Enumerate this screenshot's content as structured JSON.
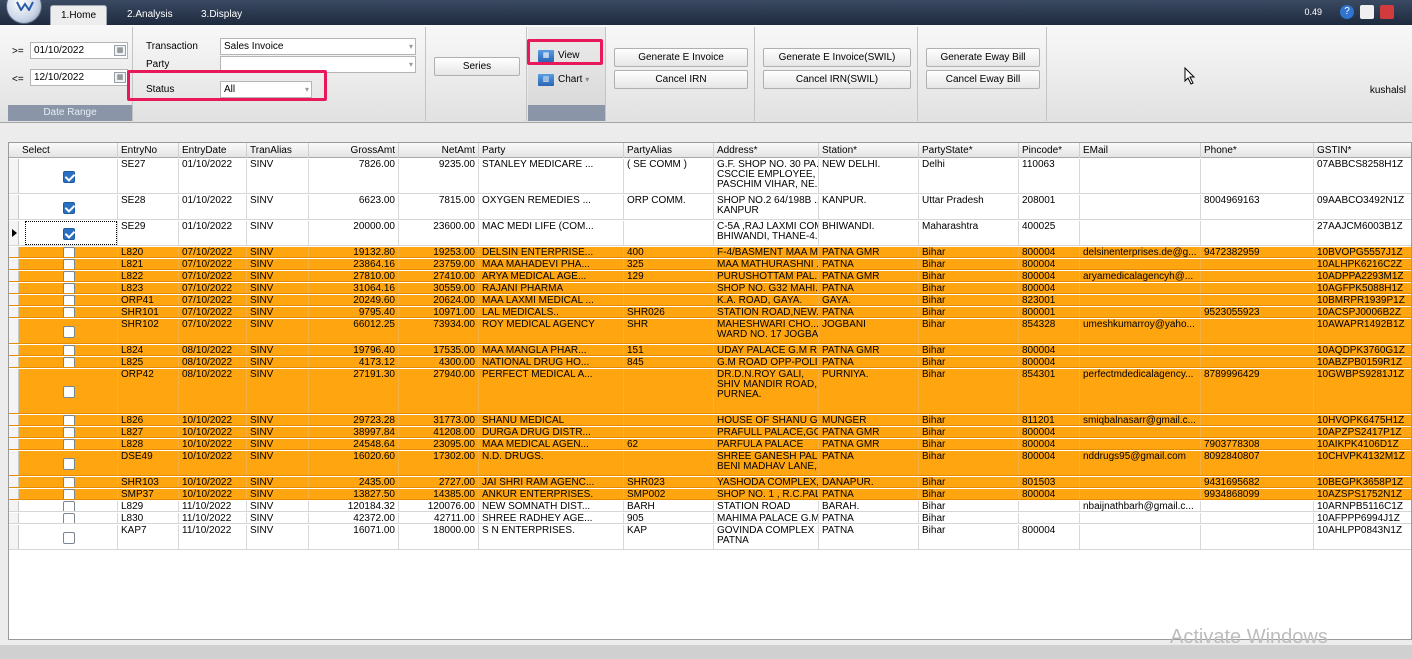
{
  "tabs": [
    {
      "label": "1.Home"
    },
    {
      "label": "2.Analysis"
    },
    {
      "label": "3.Display"
    }
  ],
  "version": "0.49",
  "date_range": {
    "from_prefix": ">=",
    "from_value": "01/10/2022",
    "to_prefix": "<=",
    "to_value": "12/10/2022",
    "group_label": "Date Range"
  },
  "filters": {
    "transaction_label": "Transaction",
    "transaction_value": "Sales Invoice",
    "party_label": "Party",
    "party_value": "",
    "status_label": "Status",
    "status_value": "All"
  },
  "buttons": {
    "series": "Series",
    "view": "View",
    "chart": "Chart",
    "generate_e_invoice": "Generate E Invoice",
    "cancel_irn": "Cancel IRN",
    "generate_e_invoice_swil": "Generate E Invoice(SWIL)",
    "cancel_irn_swil": "Cancel IRN(SWIL)",
    "generate_eway_bill": "Generate Eway Bill",
    "cancel_eway_bill": "Cancel Eway Bill"
  },
  "username": "kushalsl",
  "watermark": "Activate Windows",
  "columns": [
    "Select",
    "EntryNo",
    "EntryDate",
    "TranAlias",
    "GrossAmt",
    "NetAmt",
    "Party",
    "PartyAlias",
    "Address*",
    "Station*",
    "PartyState*",
    "Pincode*",
    "EMail",
    "Phone*",
    "GSTIN*"
  ],
  "rows": [
    {
      "checked": true,
      "color": "white",
      "lines": 3,
      "entry": "SE27",
      "date": "01/10/2022",
      "alias": "SINV",
      "gross": "7826.00",
      "net": "9235.00",
      "party": "STANLEY MEDICARE ...",
      "palias": "( SE COMM )",
      "address": "G.F. SHOP NO. 30 PA...\nCSCCIE EMPLOYEE, ...\nPASCHIM VIHAR, NE...",
      "station": "NEW DELHI.",
      "state": "Delhi",
      "pin": "110063",
      "email": "",
      "phone": "",
      "gstin": "07ABBCS8258H1Z"
    },
    {
      "checked": true,
      "color": "white",
      "lines": 2,
      "entry": "SE28",
      "date": "01/10/2022",
      "alias": "SINV",
      "gross": "6623.00",
      "net": "7815.00",
      "party": "OXYGEN REMEDIES ...",
      "palias": "ORP COMM.",
      "address": "SHOP NO.2 64/198B ...\nKANPUR",
      "station": "KANPUR.",
      "state": "Uttar Pradesh",
      "pin": "208001",
      "email": "",
      "phone": "8004969163",
      "gstin": "09AABCO3492N1Z"
    },
    {
      "checked": true,
      "color": "white",
      "lines": 2,
      "current": true,
      "entry": "SE29",
      "date": "01/10/2022",
      "alias": "SINV",
      "gross": "20000.00",
      "net": "23600.00",
      "party": "MAC MEDI LIFE (COM...",
      "palias": "",
      "address": "C-5A ,RAJ LAXMI COM...\nBHIWANDI, THANE-4...",
      "station": "BHIWANDI.",
      "state": "Maharashtra",
      "pin": "400025",
      "email": "",
      "phone": "",
      "gstin": "27AAJCM6003B1Z"
    },
    {
      "checked": false,
      "color": "orange",
      "lines": 1,
      "entry": "L820",
      "date": "07/10/2022",
      "alias": "SINV",
      "gross": "19132.80",
      "net": "19253.00",
      "party": "DELSIN ENTERPRISE...",
      "palias": "400",
      "address": "F-4/BASMENT MAA M...",
      "station": "PATNA GMR",
      "state": "Bihar",
      "pin": "800004",
      "email": "delsinenterprises.de@g...",
      "phone": "9472382959",
      "gstin": "10BVOPG5557J1Z"
    },
    {
      "checked": false,
      "color": "orange",
      "lines": 1,
      "entry": "L821",
      "date": "07/10/2022",
      "alias": "SINV",
      "gross": "23864.16",
      "net": "23759.00",
      "party": "MAA MAHADEVI PHA...",
      "palias": "325",
      "address": "MAA MATHURASHNI ...",
      "station": "PATNA",
      "state": "Bihar",
      "pin": "800004",
      "email": "",
      "phone": "",
      "gstin": "10ALHPK6216C2Z"
    },
    {
      "checked": false,
      "color": "orange",
      "lines": 1,
      "entry": "L822",
      "date": "07/10/2022",
      "alias": "SINV",
      "gross": "27810.00",
      "net": "27410.00",
      "party": "ARYA MEDICAL AGE...",
      "palias": "129",
      "address": "PURUSHOTTAM PAL...",
      "station": "PATNA GMR",
      "state": "Bihar",
      "pin": "800004",
      "email": "aryamedicalagencyh@...",
      "phone": "",
      "gstin": "10ADPPA2293M1Z"
    },
    {
      "checked": false,
      "color": "orange",
      "lines": 1,
      "entry": "L823",
      "date": "07/10/2022",
      "alias": "SINV",
      "gross": "31064.16",
      "net": "30559.00",
      "party": "RAJANI PHARMA",
      "palias": "",
      "address": "SHOP NO. G32 MAHI...",
      "station": "PATNA",
      "state": "Bihar",
      "pin": "800004",
      "email": "",
      "phone": "",
      "gstin": "10AGFPK5088H1Z"
    },
    {
      "checked": false,
      "color": "orange",
      "lines": 1,
      "entry": "ORP41",
      "date": "07/10/2022",
      "alias": "SINV",
      "gross": "20249.60",
      "net": "20624.00",
      "party": "MAA LAXMI MEDICAL ...",
      "palias": "",
      "address": "K.A. ROAD, GAYA.",
      "station": "GAYA.",
      "state": "Bihar",
      "pin": "823001",
      "email": "",
      "phone": "",
      "gstin": "10BMRPR1939P1Z"
    },
    {
      "checked": false,
      "color": "orange",
      "lines": 1,
      "entry": "SHR101",
      "date": "07/10/2022",
      "alias": "SINV",
      "gross": "9795.40",
      "net": "10971.00",
      "party": "LAL MEDICALS..",
      "palias": "SHR026",
      "address": "STATION ROAD,NEW...",
      "station": "PATNA",
      "state": "Bihar",
      "pin": "800001",
      "email": "",
      "phone": "9523055923",
      "gstin": "10ACSPJ0006B2Z"
    },
    {
      "checked": false,
      "color": "orange",
      "lines": 2,
      "entry": "SHR102",
      "date": "07/10/2022",
      "alias": "SINV",
      "gross": "66012.25",
      "net": "73934.00",
      "party": "ROY MEDICAL AGENCY",
      "palias": "SHR",
      "address": "MAHESHWARI CHO...\nWARD NO. 17 JOGBA...",
      "station": "JOGBANI",
      "state": "Bihar",
      "pin": "854328",
      "email": "umeshkumarroy@yaho...",
      "phone": "",
      "gstin": "10AWAPR1492B1Z"
    },
    {
      "checked": false,
      "color": "orange",
      "lines": 1,
      "entry": "L824",
      "date": "08/10/2022",
      "alias": "SINV",
      "gross": "19796.40",
      "net": "17535.00",
      "party": "MAA MANGLA PHAR...",
      "palias": "151",
      "address": "UDAY PALACE G.M R...",
      "station": "PATNA GMR",
      "state": "Bihar",
      "pin": "800004",
      "email": "",
      "phone": "",
      "gstin": "10AQDPK3760G1Z"
    },
    {
      "checked": false,
      "color": "orange",
      "lines": 1,
      "entry": "L825",
      "date": "08/10/2022",
      "alias": "SINV",
      "gross": "4173.12",
      "net": "4300.00",
      "party": "NATIONAL DRUG HO...",
      "palias": "845",
      "address": "G.M ROAD OPP-POLI...",
      "station": "PATNA",
      "state": "Bihar",
      "pin": "800004",
      "email": "",
      "phone": "",
      "gstin": "10ABZPB0159R1Z"
    },
    {
      "checked": false,
      "color": "orange",
      "lines": 4,
      "entry": "ORP42",
      "date": "08/10/2022",
      "alias": "SINV",
      "gross": "27191.30",
      "net": "27940.00",
      "party": "PERFECT MEDICAL A...",
      "palias": "",
      "address": "DR.D.N.ROY GALI,\nSHIV MANDIR ROAD,...\nPURNEA.",
      "station": "PURNIYA.",
      "state": "Bihar",
      "pin": "854301",
      "email": "perfectmdedicalagency...",
      "phone": "8789996429",
      "gstin": "10GWBPS9281J1Z"
    },
    {
      "checked": false,
      "color": "orange",
      "lines": 1,
      "entry": "L826",
      "date": "10/10/2022",
      "alias": "SINV",
      "gross": "29723.28",
      "net": "31773.00",
      "party": "SHANU MEDICAL",
      "palias": "",
      "address": "HOUSE OF SHANU G...",
      "station": "MUNGER",
      "state": "Bihar",
      "pin": "811201",
      "email": "smiqbalnasarr@gmail.c...",
      "phone": "",
      "gstin": "10HVOPK6475H1Z"
    },
    {
      "checked": false,
      "color": "orange",
      "lines": 1,
      "entry": "L827",
      "date": "10/10/2022",
      "alias": "SINV",
      "gross": "38997.84",
      "net": "41208.00",
      "party": "DURGA DRUG DISTR...",
      "palias": "",
      "address": "PRAFULL PALACE,GO...",
      "station": "PATNA GMR",
      "state": "Bihar",
      "pin": "800004",
      "email": "",
      "phone": "",
      "gstin": "10APZPS2417P1Z"
    },
    {
      "checked": false,
      "color": "orange",
      "lines": 1,
      "entry": "L828",
      "date": "10/10/2022",
      "alias": "SINV",
      "gross": "24548.64",
      "net": "23095.00",
      "party": "MAA MEDICAL AGEN...",
      "palias": "62",
      "address": "PARFULA PALACE",
      "station": "PATNA GMR",
      "state": "Bihar",
      "pin": "800004",
      "email": "",
      "phone": "7903778308",
      "gstin": "10AIKPK4106D1Z"
    },
    {
      "checked": false,
      "color": "orange",
      "lines": 2,
      "entry": "DSE49",
      "date": "10/10/2022",
      "alias": "SINV",
      "gross": "16020.60",
      "net": "17302.00",
      "party": "N.D. DRUGS.",
      "palias": "",
      "address": "SHREE GANESH PAL...\nBENI MADHAV LANE,...",
      "station": "PATNA",
      "state": "Bihar",
      "pin": "800004",
      "email": "nddrugs95@gmail.com",
      "phone": "8092840807",
      "gstin": "10CHVPK4132M1Z"
    },
    {
      "checked": false,
      "color": "orange",
      "lines": 1,
      "entry": "SHR103",
      "date": "10/10/2022",
      "alias": "SINV",
      "gross": "2435.00",
      "net": "2727.00",
      "party": "JAI SHRI RAM AGENC...",
      "palias": "SHR023",
      "address": "YASHODA COMPLEX,...",
      "station": "DANAPUR.",
      "state": "Bihar",
      "pin": "801503",
      "email": "",
      "phone": "9431695682",
      "gstin": "10BEGPK3658P1Z"
    },
    {
      "checked": false,
      "color": "orange",
      "lines": 1,
      "entry": "SMP37",
      "date": "10/10/2022",
      "alias": "SINV",
      "gross": "13827.50",
      "net": "14385.00",
      "party": "ANKUR ENTERPRISES.",
      "palias": "SMP002",
      "address": "SHOP NO. 1 , R.C.PAL...",
      "station": "PATNA",
      "state": "Bihar",
      "pin": "800004",
      "email": "",
      "phone": "9934868099",
      "gstin": "10AZSPS1752N1Z"
    },
    {
      "checked": false,
      "color": "white",
      "lines": 1,
      "entry": "L829",
      "date": "11/10/2022",
      "alias": "SINV",
      "gross": "120184.32",
      "net": "120076.00",
      "party": "NEW SOMNATH DIST...",
      "palias": "BARH",
      "address": "STATION ROAD",
      "station": "BARAH.",
      "state": "Bihar",
      "pin": "",
      "email": "nbaijnathbarh@gmail.c...",
      "phone": "",
      "gstin": "10ARNPB5116C1Z"
    },
    {
      "checked": false,
      "color": "white",
      "lines": 1,
      "entry": "L830",
      "date": "11/10/2022",
      "alias": "SINV",
      "gross": "42372.00",
      "net": "42711.00",
      "party": "SHREE RADHEY AGE...",
      "palias": "905",
      "address": "MAHIMA PALACE G.M...",
      "station": "PATNA",
      "state": "Bihar",
      "pin": "",
      "email": "",
      "phone": "",
      "gstin": "10AFPPP6994J1Z"
    },
    {
      "checked": false,
      "color": "white",
      "lines": 2,
      "entry": "KAP7",
      "date": "11/10/2022",
      "alias": "SINV",
      "gross": "16071.00",
      "net": "18000.00",
      "party": "S N ENTERPRISES.",
      "palias": "KAP",
      "address": "GOVINDA COMPLEX ...\nPATNA",
      "station": "PATNA",
      "state": "Bihar",
      "pin": "800004",
      "email": "",
      "phone": "",
      "gstin": "10AHLPP0843N1Z"
    }
  ]
}
